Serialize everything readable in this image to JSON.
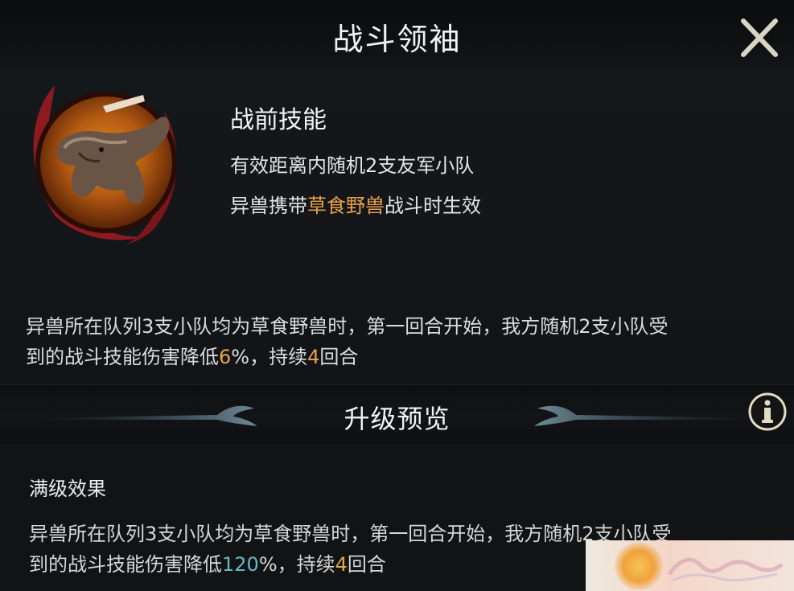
{
  "header": {
    "title": "战斗领袖"
  },
  "skill": {
    "title": "战前技能",
    "line1": "有效距离内随机2支友军小队",
    "line2_prefix": "异兽携带",
    "line2_highlight": "草食野兽",
    "line2_suffix": "战斗时生效",
    "portrait_icon": "elephant-beast-portrait"
  },
  "current_effect": {
    "line1": "异兽所在队列3支小队均为草食野兽时，第一回合开始，我方随机2支小队受",
    "line2_prefix": "到的战斗技能伤害降低",
    "value": "6",
    "line2_mid": "%，持续",
    "turns": "4",
    "line2_suffix": "回合"
  },
  "upgrade": {
    "title": "升级预览",
    "full_level_title": "满级效果",
    "line1": "异兽所在队列3支小队均为草食野兽时，第一回合开始，我方随机2支小队受",
    "line2_prefix": "到的战斗技能伤害降低",
    "value": "120",
    "line2_mid": "%，持续",
    "turns": "4",
    "line2_suffix": "回合"
  },
  "icons": {
    "close": "close-icon",
    "info": "info-icon"
  },
  "colors": {
    "highlight_orange": "#e7a14a",
    "upgrade_value_teal": "#67b7c4",
    "background": "#111315"
  }
}
